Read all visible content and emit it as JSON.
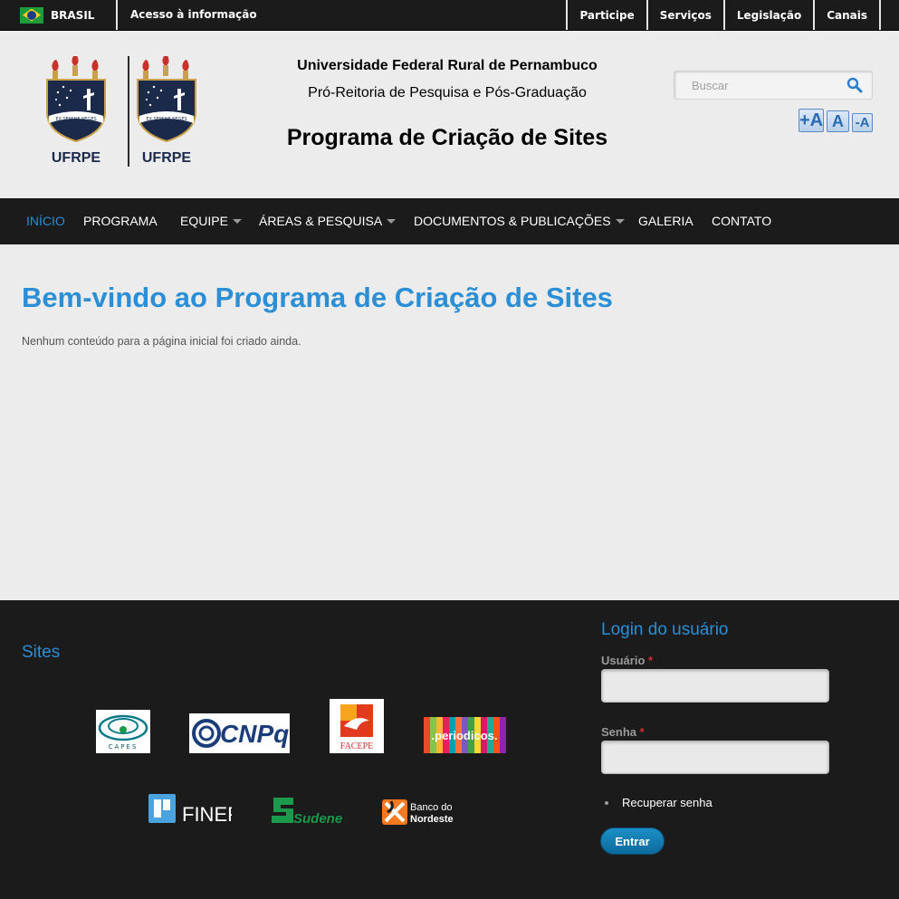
{
  "govbar": {
    "country": "BRASIL",
    "access_info": "Acesso à informação",
    "links": [
      "Participe",
      "Serviços",
      "Legislação",
      "Canais"
    ]
  },
  "header": {
    "logo_label_left": "UFRPE",
    "logo_label_right": "UFRPE",
    "university": "Universidade Federal Rural de Pernambuco",
    "pro_reitoria": "Pró-Reitoria de Pesquisa e Pós-Graduação",
    "site_title": "Programa de Criação de Sites",
    "search": {
      "placeholder": "Buscar"
    },
    "font_controls": [
      "+A",
      "A",
      "-A"
    ]
  },
  "nav": {
    "items": [
      {
        "label": "INÍCIO",
        "active": true
      },
      {
        "label": "PROGRAMA"
      },
      {
        "label": "EQUIPE",
        "dropdown": true
      },
      {
        "label": "ÁREAS & PESQUISA",
        "dropdown": true
      },
      {
        "label": "DOCUMENTOS & PUBLICAÇÕES",
        "dropdown": true
      },
      {
        "label": "GALERIA"
      },
      {
        "label": "CONTATO"
      }
    ]
  },
  "content": {
    "heading": "Bem-vindo ao Programa de Criação de Sites",
    "body": "Nenhum conteúdo para a página inicial foi criado ainda."
  },
  "footer": {
    "sites_title": "Sites",
    "partners": {
      "capes": "CAPES",
      "cnpq": "CNPq",
      "facepe": "FACEPE",
      "periodicos": ".periodicos.",
      "finep": "FINEP",
      "sudene": "Sudene",
      "bnb_line1": "Banco do",
      "bnb_line2": "Nordeste"
    },
    "login": {
      "title": "Login do usuário",
      "user_label": "Usuário",
      "password_label": "Senha",
      "required_mark": "*",
      "recover": "Recuperar senha",
      "submit": "Entrar"
    }
  },
  "colors": {
    "accent": "#2a8fd6",
    "dark": "#1b1b1b",
    "background": "#ececec"
  }
}
